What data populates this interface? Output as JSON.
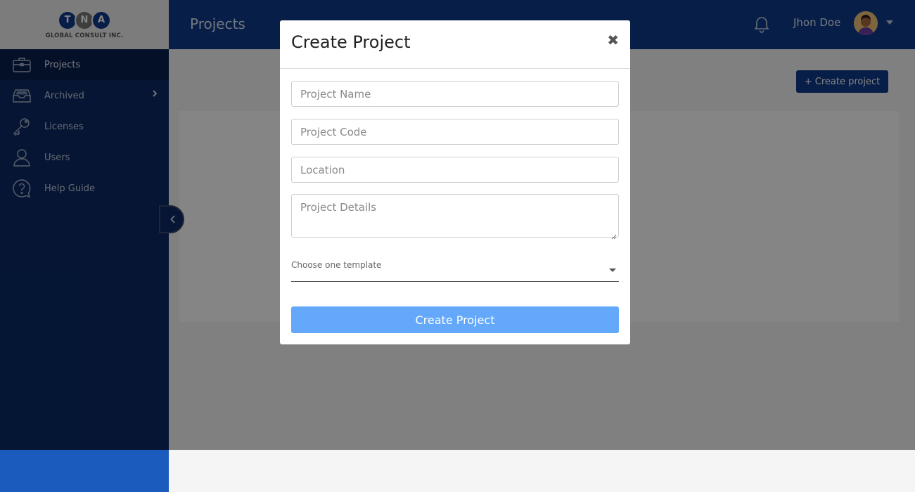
{
  "logo": {
    "letters": [
      "T",
      "N",
      "A"
    ],
    "company": "GLOBAL CONSULT INC."
  },
  "sidebar": {
    "items": [
      {
        "label": "Projects",
        "icon": "briefcase-icon",
        "active": true
      },
      {
        "label": "Archived",
        "icon": "archive-box-icon",
        "has_submenu": true
      },
      {
        "label": "Licenses",
        "icon": "key-icon"
      },
      {
        "label": "Users",
        "icon": "user-icon"
      },
      {
        "label": "Help Guide",
        "icon": "help-bubble-icon"
      }
    ]
  },
  "topbar": {
    "title": "Projects",
    "user_name": "Jhon Doe"
  },
  "content": {
    "create_button_label": "+ Create project"
  },
  "modal": {
    "title": "Create Project",
    "close_glyph": "✖",
    "fields": {
      "project_name_placeholder": "Project Name",
      "project_code_placeholder": "Project Code",
      "location_placeholder": "Location",
      "project_details_placeholder": "Project Details"
    },
    "template_select_label": "Choose one template",
    "submit_label": "Create Project"
  },
  "colors": {
    "sidebar_bg": "#0a2a63",
    "topbar_bg": "#0e3a8a",
    "primary_button": "#0e3a8a",
    "submit_button": "#63a8fa",
    "sidebar_footer": "#1a5bbd"
  }
}
